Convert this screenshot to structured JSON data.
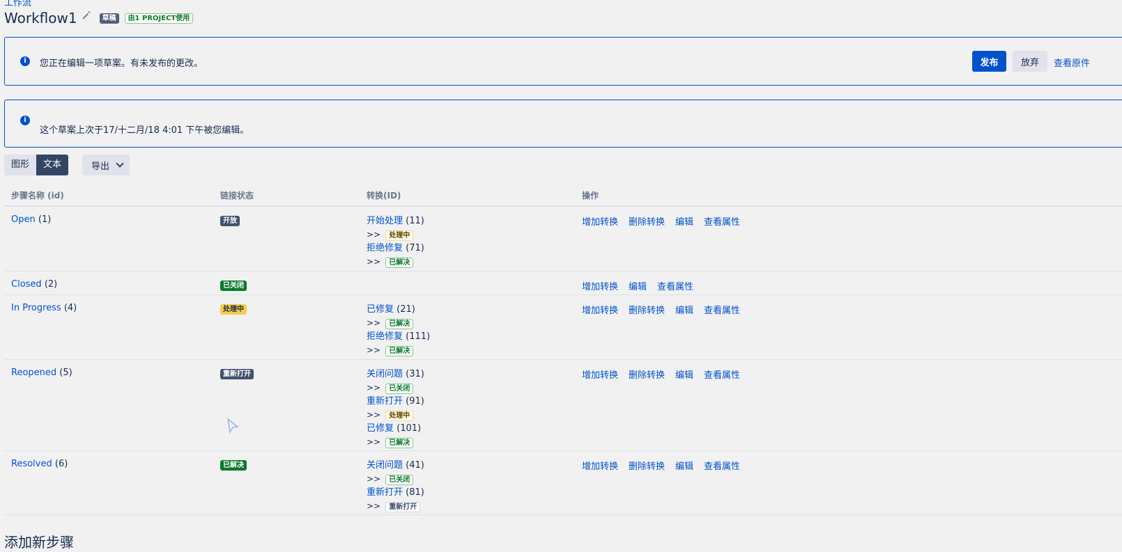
{
  "breadcrumb": "工作流",
  "header": {
    "title": "Workflow1",
    "draft_badge": "草稿",
    "used_badge": "由1 PROJECT使用"
  },
  "messages": {
    "editing_draft": "您正在编辑一项草案。有未发布的更改。",
    "last_edited": "这个草案上次于17/十二月/18 4:01 下午被您编辑。",
    "publish": "发布",
    "discard": "放弃",
    "view_original": "查看原件"
  },
  "view_tabs": {
    "graph": "图形",
    "text": "文本",
    "export": "导出"
  },
  "table": {
    "headers": [
      "步骤名称 (id)",
      "链接状态",
      "转换(ID)",
      "操作"
    ],
    "actions": {
      "add": "增加转换",
      "delete": "删除转换",
      "edit": "编辑",
      "props": "查看属性"
    },
    "rows": [
      {
        "name": "Open",
        "id": "(1)",
        "status": "开放",
        "status_color": "blue",
        "transitions": [
          {
            "name": "开始处理",
            "id": "(11)",
            "arrow": ">>",
            "target": "处理中",
            "target_color": "yellow"
          },
          {
            "name": "拒绝修复",
            "id": "(71)",
            "arrow": ">>",
            "target": "已解决",
            "target_color": "green"
          }
        ]
      },
      {
        "name": "Closed",
        "id": "(2)",
        "status": "已关闭",
        "status_color": "green",
        "transitions": []
      },
      {
        "name": "In Progress",
        "id": "(4)",
        "status": "处理中",
        "status_color": "yellow",
        "transitions": [
          {
            "name": "已修复",
            "id": "(21)",
            "arrow": ">>",
            "target": "已解决",
            "target_color": "green"
          },
          {
            "name": "拒绝修复",
            "id": "(111)",
            "arrow": ">>",
            "target": "已解决",
            "target_color": "green"
          }
        ]
      },
      {
        "name": "Reopened",
        "id": "(5)",
        "status": "重新打开",
        "status_color": "blue",
        "transitions": [
          {
            "name": "关闭问题",
            "id": "(31)",
            "arrow": ">>",
            "target": "已关闭",
            "target_color": "green"
          },
          {
            "name": "重新打开",
            "id": "(91)",
            "arrow": ">>",
            "target": "处理中",
            "target_color": "yellow"
          },
          {
            "name": "已修复",
            "id": "(101)",
            "arrow": ">>",
            "target": "已解决",
            "target_color": "green"
          }
        ]
      },
      {
        "name": "Resolved",
        "id": "(6)",
        "status": "已解决",
        "status_color": "green",
        "transitions": [
          {
            "name": "关闭问题",
            "id": "(41)",
            "arrow": ">>",
            "target": "已关闭",
            "target_color": "green"
          },
          {
            "name": "重新打开",
            "id": "(81)",
            "arrow": ">>",
            "target": "重新打开",
            "target_color": "gray"
          }
        ]
      }
    ]
  },
  "add_step_heading": "添加新步骤",
  "colors": {
    "accent": "#0052cc",
    "draft_badge": "#505f79",
    "status_blue": "#42526e",
    "status_green": "#0a7a2a",
    "status_yellow": "#f5cd47"
  },
  "icons": [
    "pencil-icon",
    "info-icon",
    "chevron-down-icon",
    "mouse-cursor-icon"
  ]
}
